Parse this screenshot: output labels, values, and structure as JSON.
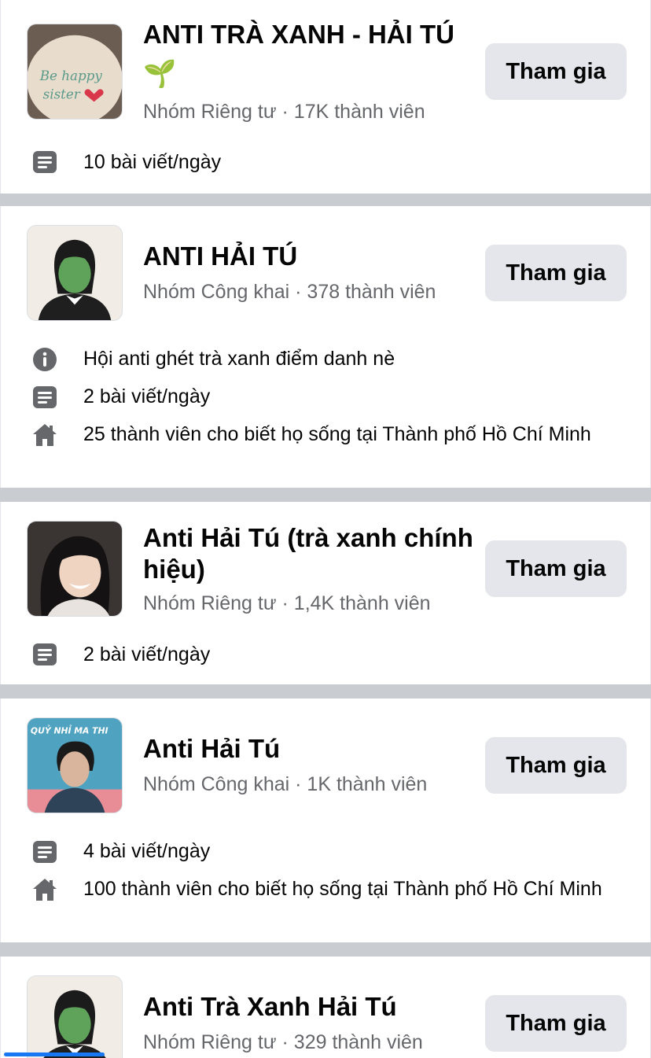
{
  "groups": [
    {
      "title": "ANTI TRÀ XANH - HẢI TÚ",
      "emoji": "🌱",
      "subtitle": "Nhóm Riêng tư · 17K thành viên",
      "join_label": "Tham gia",
      "thumb_text": "Be happy sister",
      "info": [
        {
          "icon": "posts-icon",
          "text": "10 bài viết/ngày"
        }
      ]
    },
    {
      "title": "ANTI HẢI TÚ",
      "subtitle": "Nhóm Công khai · 378 thành viên",
      "join_label": "Tham gia",
      "info": [
        {
          "icon": "info-icon",
          "text": "Hội anti ghét trà xanh điểm danh nè"
        },
        {
          "icon": "posts-icon",
          "text": "2 bài viết/ngày"
        },
        {
          "icon": "home-icon",
          "text": "25 thành viên cho biết họ sống tại Thành phố Hồ Chí Minh"
        }
      ]
    },
    {
      "title": "Anti Hải Tú (trà xanh chính hiệu)",
      "subtitle": "Nhóm Riêng tư · 1,4K thành viên",
      "join_label": "Tham gia",
      "info": [
        {
          "icon": "posts-icon",
          "text": "2 bài viết/ngày"
        }
      ]
    },
    {
      "title": "Anti Hải Tú",
      "subtitle": "Nhóm Công khai · 1K thành viên",
      "join_label": "Tham gia",
      "thumb_text": "QUỶ NHỈ MA THI",
      "info": [
        {
          "icon": "posts-icon",
          "text": "4 bài viết/ngày"
        },
        {
          "icon": "home-icon",
          "text": "100 thành viên cho biết họ sống tại Thành phố Hồ Chí Minh"
        }
      ]
    },
    {
      "title": "Anti Trà Xanh Hải Tú",
      "subtitle": "Nhóm Riêng tư · 329 thành viên",
      "join_label": "Tham gia",
      "info": []
    }
  ],
  "colors": {
    "separator": "#c9ccd1",
    "button_bg": "#e4e6eb",
    "secondary_text": "#65676b",
    "icon": "#65676b",
    "scroll_indicator": "#1877f2"
  }
}
